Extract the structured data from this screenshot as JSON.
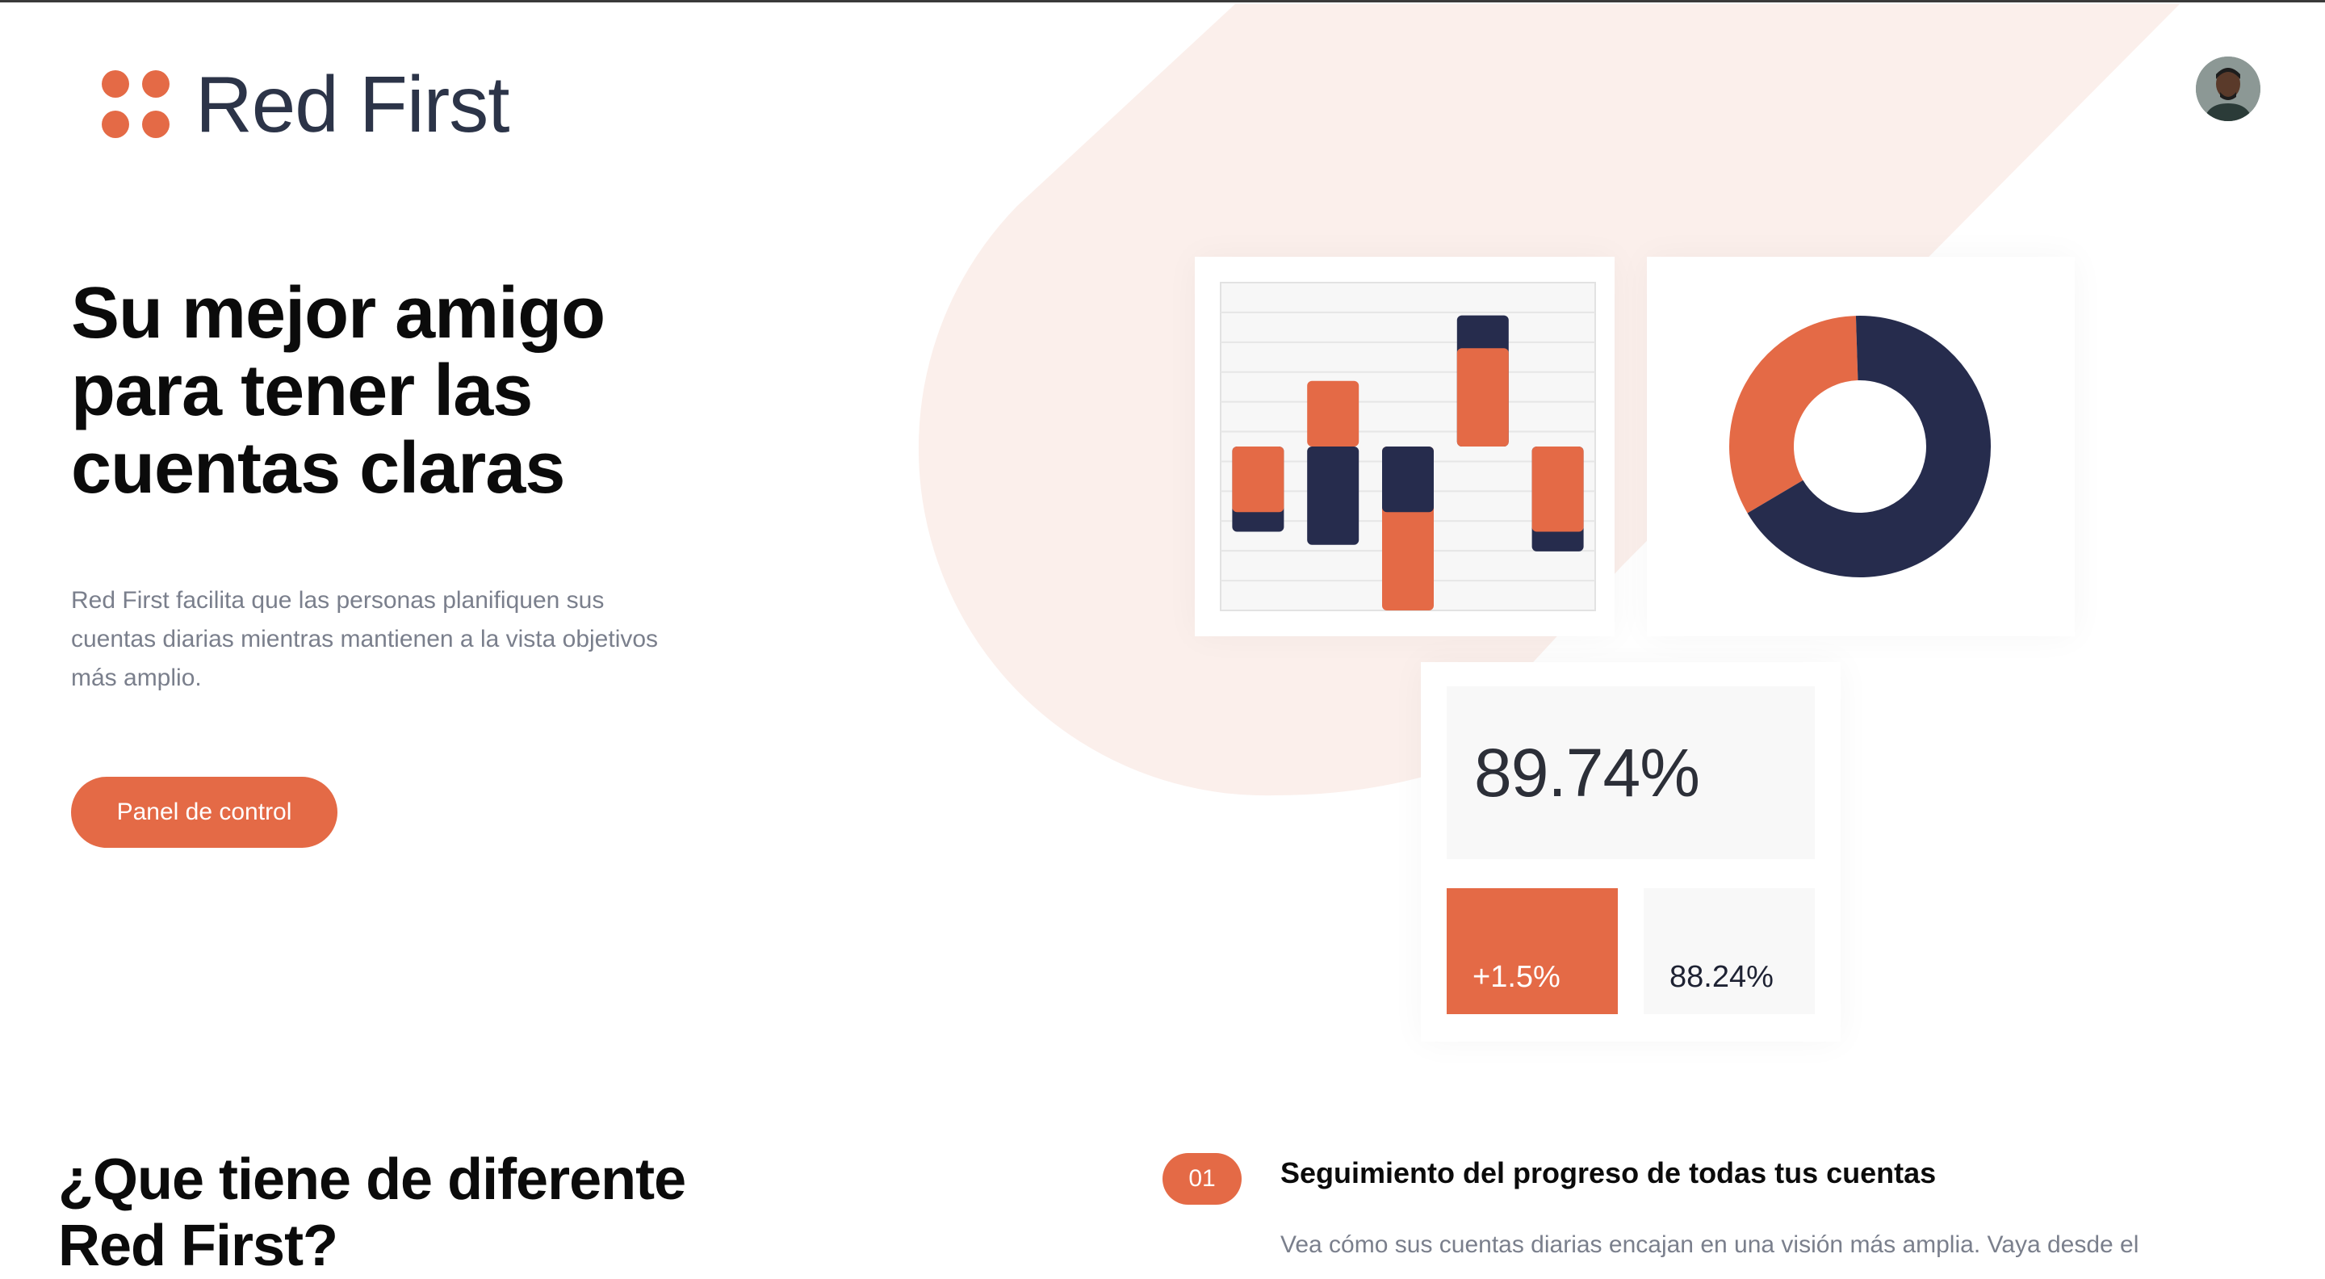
{
  "brand": {
    "name": "Red First",
    "color": "#e46a46",
    "logo_icon": "four-dots-icon"
  },
  "header": {
    "avatar_icon": "user-avatar-icon"
  },
  "hero": {
    "title": "Su mejor amigo para tener las cuentas claras",
    "description": "Red First facilita que las personas planifiquen sus cuentas diarias mientras mantienen a la vista objetivos más amplio.",
    "cta_label": "Panel de control"
  },
  "widgets": {
    "big_stat": "89.74%",
    "change_stat": "+1.5%",
    "secondary_stat": "88.24%"
  },
  "chart_data": [
    {
      "type": "bar",
      "series": [
        {
          "name": "",
          "color": "#e46a46",
          "values": [
            -1.0,
            1.0,
            -2.5,
            1.5,
            -1.3
          ]
        },
        {
          "name": "",
          "color": "#262c4d",
          "values": [
            -1.3,
            -1.5,
            -1.0,
            2.0,
            -1.6
          ]
        }
      ],
      "ylim": [
        -2.5,
        2.5
      ]
    },
    {
      "type": "pie",
      "series": [
        {
          "name": "",
          "color": "#e46a46",
          "values": [
            0.33
          ]
        },
        {
          "name": "",
          "color": "#262c4d",
          "values": [
            0.67
          ]
        }
      ]
    }
  ],
  "features": {
    "title": "¿Que tiene de diferente Red First?",
    "items": [
      {
        "number": "01",
        "title": "Seguimiento del progreso de todas tus cuentas",
        "description": "Vea cómo sus cuentas diarias encajan en una visión más amplia. Vaya desde el"
      }
    ]
  },
  "colors": {
    "accent": "#e46a46",
    "navy": "#262c4d",
    "blob": "#fbefeb"
  }
}
